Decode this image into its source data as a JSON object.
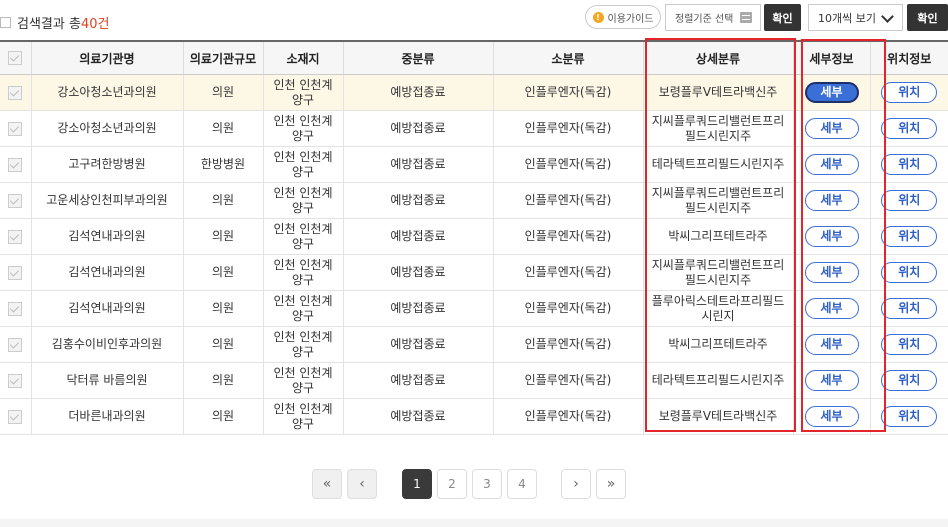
{
  "toolbar": {
    "result_prefix": "검색결과 총",
    "result_count": "40건",
    "guide_label": "이용가이드",
    "sort_label": "정렬기준 선택",
    "confirm_label": "확인",
    "perpage_value": "10개씩 보기",
    "confirm2_label": "확인"
  },
  "table": {
    "headers": [
      "의료기관명",
      "의료기관규모",
      "소재지",
      "중분류",
      "소분류",
      "상세분류",
      "세부정보",
      "위치정보"
    ],
    "detail_label": "세부",
    "location_label": "위치",
    "rows": [
      {
        "name": "강소아청소년과의원",
        "size": "의원",
        "loc1": "인천 인천계",
        "loc2": "양구",
        "mid": "예방접종료",
        "small": "인플루엔자(독감)",
        "det1": "보령플루Ⅴ테트라백신주",
        "det2": ""
      },
      {
        "name": "강소아청소년과의원",
        "size": "의원",
        "loc1": "인천 인천계",
        "loc2": "양구",
        "mid": "예방접종료",
        "small": "인플루엔자(독감)",
        "det1": "지씨플루쿼드리밸런트프리",
        "det2": "필드시린지주"
      },
      {
        "name": "고구려한방병원",
        "size": "한방병원",
        "loc1": "인천 인천계",
        "loc2": "양구",
        "mid": "예방접종료",
        "small": "인플루엔자(독감)",
        "det1": "테라텍트프리필드시린지주",
        "det2": ""
      },
      {
        "name": "고운세상인천피부과의원",
        "size": "의원",
        "loc1": "인천 인천계",
        "loc2": "양구",
        "mid": "예방접종료",
        "small": "인플루엔자(독감)",
        "det1": "지씨플루쿼드리밸런트프리",
        "det2": "필드시린지주"
      },
      {
        "name": "김석연내과의원",
        "size": "의원",
        "loc1": "인천 인천계",
        "loc2": "양구",
        "mid": "예방접종료",
        "small": "인플루엔자(독감)",
        "det1": "박씨그리프테트라주",
        "det2": ""
      },
      {
        "name": "김석연내과의원",
        "size": "의원",
        "loc1": "인천 인천계",
        "loc2": "양구",
        "mid": "예방접종료",
        "small": "인플루엔자(독감)",
        "det1": "지씨플루쿼드리밸런트프리",
        "det2": "필드시린지주"
      },
      {
        "name": "김석연내과의원",
        "size": "의원",
        "loc1": "인천 인천계",
        "loc2": "양구",
        "mid": "예방접종료",
        "small": "인플루엔자(독감)",
        "det1": "플루아릭스테트라프리필드",
        "det2": "시린지"
      },
      {
        "name": "김홍수이비인후과의원",
        "size": "의원",
        "loc1": "인천 인천계",
        "loc2": "양구",
        "mid": "예방접종료",
        "small": "인플루엔자(독감)",
        "det1": "박씨그리프테트라주",
        "det2": ""
      },
      {
        "name": "닥터류 바름의원",
        "size": "의원",
        "loc1": "인천 인천계",
        "loc2": "양구",
        "mid": "예방접종료",
        "small": "인플루엔자(독감)",
        "det1": "테라텍트프리필드시린지주",
        "det2": ""
      },
      {
        "name": "더바른내과의원",
        "size": "의원",
        "loc1": "인천 인천계",
        "loc2": "양구",
        "mid": "예방접종료",
        "small": "인플루엔자(독감)",
        "det1": "보령플루Ⅴ테트라백신주",
        "det2": ""
      }
    ]
  },
  "pagination": {
    "first": "«",
    "prev": "‹",
    "pages": [
      "1",
      "2",
      "3",
      "4"
    ],
    "next": "›",
    "last": "»"
  }
}
